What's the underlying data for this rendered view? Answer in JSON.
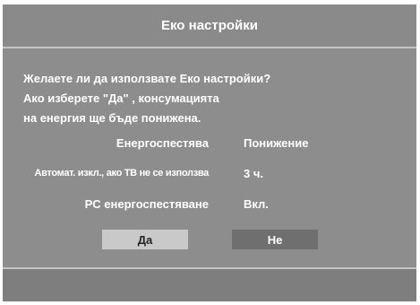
{
  "dialog": {
    "title": "Еко настройки",
    "message_lines": [
      "Желаете ли да използвате Еко настройки?",
      "Ако изберете \"Да\" , консумацията",
      "на енергия ще бъде понижена."
    ],
    "settings": [
      {
        "label": "Енергоспестява",
        "value": "Понижение"
      },
      {
        "label": "Автомат. изкл., ако ТВ не се използва",
        "value": "3 ч."
      },
      {
        "label": "PC енергоспестяване",
        "value": "Вкл."
      }
    ],
    "buttons": {
      "yes_label": "Да",
      "no_label": "Не",
      "focused": "yes"
    }
  },
  "colors": {
    "dialog_bg": "#8d8d8d",
    "divider": "#c4c4c4",
    "button_focused": "#c9c9c9",
    "button_normal": "#6f6f6f",
    "footer_bg": "#7e7e7e"
  }
}
